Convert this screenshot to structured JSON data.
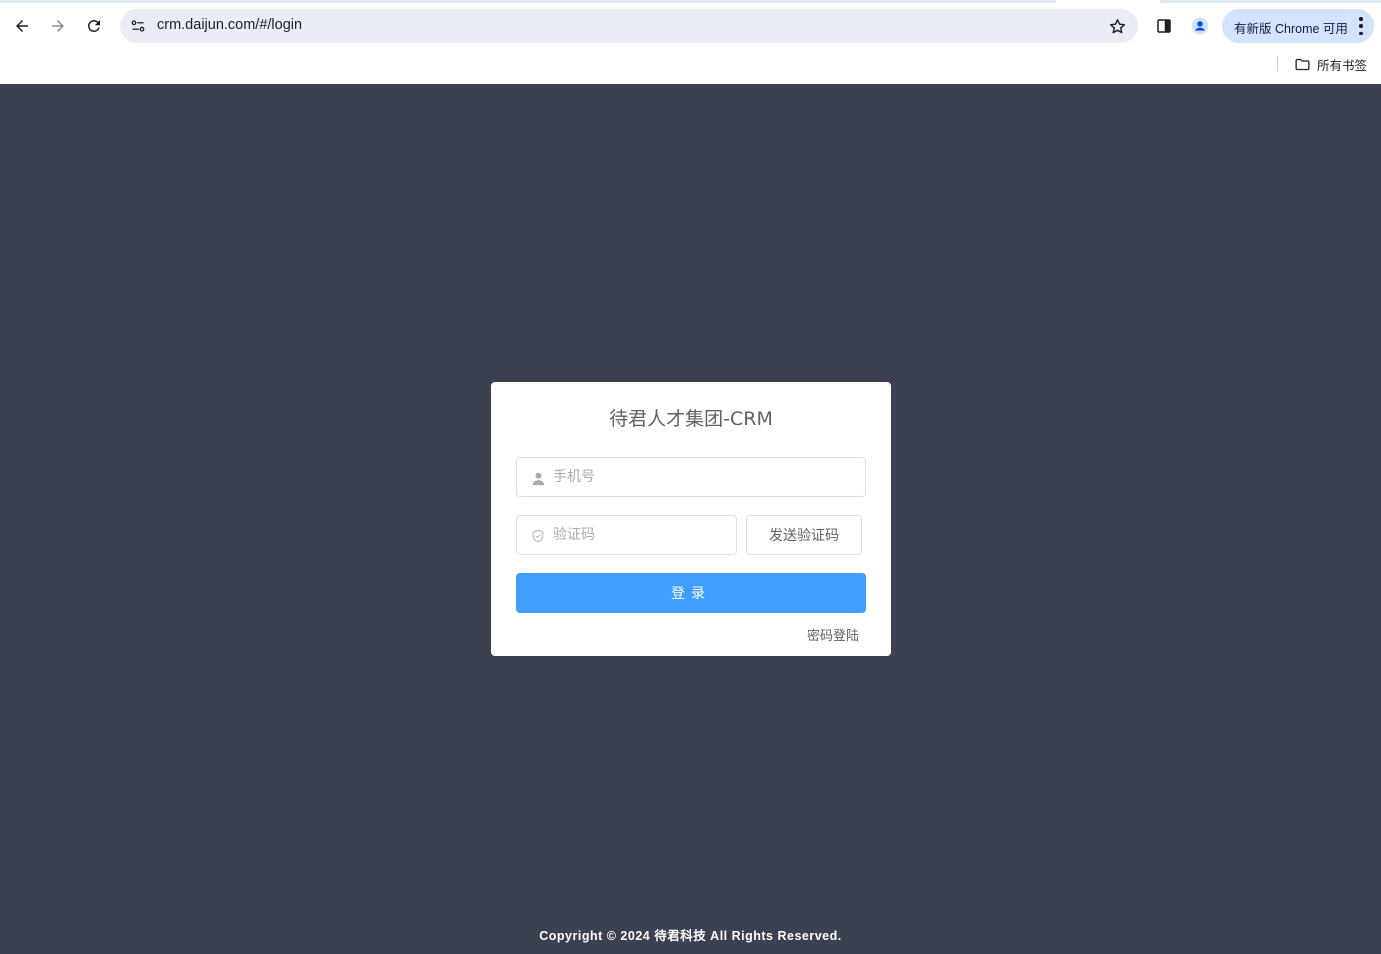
{
  "browser": {
    "url": "crm.daijun.com/#/login",
    "update_label": "有新版 Chrome 可用",
    "bookmarks_label": "所有书签"
  },
  "login": {
    "title": "待君人才集团-CRM",
    "phone_placeholder": "手机号",
    "code_placeholder": "验证码",
    "send_code_label": "发送验证码",
    "submit_label": "登录",
    "password_login_label": "密码登陆"
  },
  "footer": {
    "copyright": "Copyright © 2024 待君科技 All Rights Reserved."
  },
  "colors": {
    "page_background": "#3c4152",
    "primary": "#409eff",
    "omnibox": "#e9edf6",
    "update_pill": "#d3e3fd"
  }
}
